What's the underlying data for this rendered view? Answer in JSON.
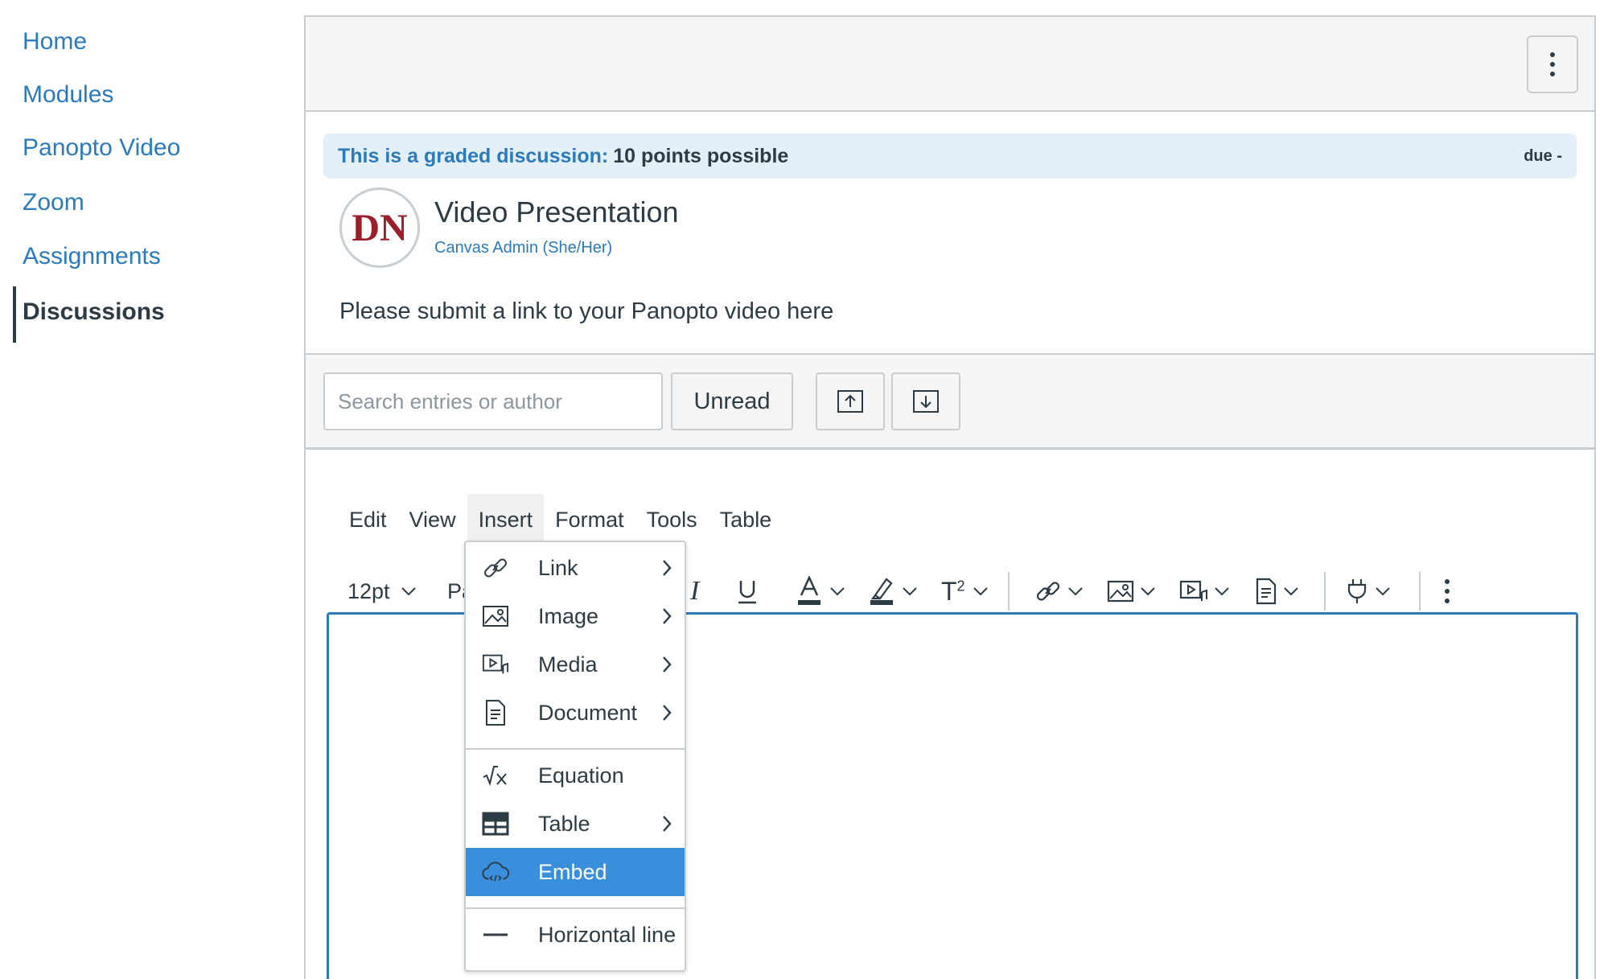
{
  "sidebar": {
    "items": [
      {
        "label": "Home"
      },
      {
        "label": "Modules"
      },
      {
        "label": "Panopto Video"
      },
      {
        "label": "Zoom"
      },
      {
        "label": "Assignments"
      },
      {
        "label": "Discussions",
        "active": true
      }
    ]
  },
  "discussion": {
    "banner_label": "This is a graded discussion:",
    "banner_points": "10 points possible",
    "due": "due -",
    "avatar_initials": "DN",
    "title": "Video Presentation",
    "author": "Canvas Admin (She/Her)",
    "body": "Please submit a link to your Panopto video here"
  },
  "controls": {
    "search_placeholder": "Search entries or author",
    "unread_label": "Unread"
  },
  "editor": {
    "menus": [
      "Edit",
      "View",
      "Insert",
      "Format",
      "Tools",
      "Table"
    ],
    "open_menu": "Insert",
    "font_size": "12pt",
    "paragraph_partial": "Pa"
  },
  "insert_menu": {
    "items": [
      {
        "label": "Link",
        "icon": "link-icon",
        "submenu": true
      },
      {
        "label": "Image",
        "icon": "image-icon",
        "submenu": true
      },
      {
        "label": "Media",
        "icon": "media-icon",
        "submenu": true
      },
      {
        "label": "Document",
        "icon": "document-icon",
        "submenu": true
      },
      {
        "label": "Equation",
        "icon": "equation-icon",
        "submenu": false
      },
      {
        "label": "Table",
        "icon": "table-icon",
        "submenu": true
      },
      {
        "label": "Embed",
        "icon": "cloud-embed-icon",
        "submenu": false,
        "highlighted": true
      },
      {
        "label": "Horizontal line",
        "icon": "horizontal-line-icon",
        "submenu": false
      }
    ]
  },
  "colors": {
    "link_blue": "#2b7abc",
    "text_dark": "#2d3b45",
    "highlight_blue": "#3a8fdc",
    "banner_bg": "#e4f0f8",
    "avatar_red": "#9b1f2a"
  }
}
